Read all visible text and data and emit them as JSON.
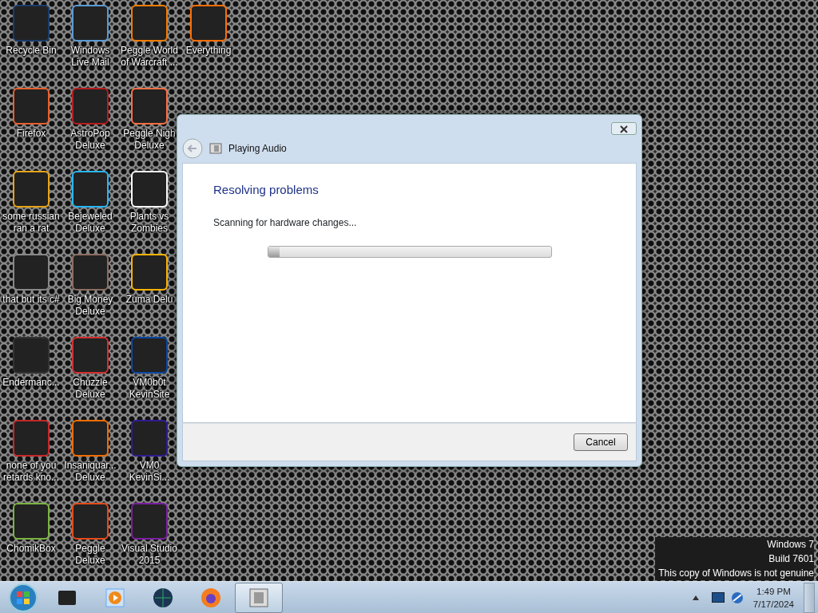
{
  "desktop_icons": [
    {
      "label": "Recycle Bin"
    },
    {
      "label": "Firefox"
    },
    {
      "label": "some russian ran a rat"
    },
    {
      "label": "that but its c#"
    },
    {
      "label": "Endermanc..."
    },
    {
      "label": "none of you retards kno..."
    },
    {
      "label": "ChomikBox"
    },
    {
      "label": "Windows Live Mail"
    },
    {
      "label": "AstroPop Deluxe"
    },
    {
      "label": "Bejeweled Deluxe"
    },
    {
      "label": "Big Money Deluxe"
    },
    {
      "label": "Chuzzle Deluxe"
    },
    {
      "label": "Insaniquar... Deluxe"
    },
    {
      "label": "Peggle Deluxe"
    },
    {
      "label": "Peggle World of Warcraft ..."
    },
    {
      "label": "Peggle Nigh Deluxe"
    },
    {
      "label": "Plants vs Zombies"
    },
    {
      "label": "Zuma Delu"
    },
    {
      "label": "VM0b0t KevinSite"
    },
    {
      "label": "VM0 KevinSi..."
    },
    {
      "label": "Visual Studio 2015"
    },
    {
      "label": "Everything"
    }
  ],
  "dialog": {
    "title": "Playing Audio",
    "heading": "Resolving problems",
    "status": "Scanning for hardware changes...",
    "progress": {
      "level": 0.04
    },
    "buttons": [
      "Cancel"
    ]
  },
  "system_notice": [
    "Windows 7",
    "Build 7601",
    "This copy of Windows is not genuine"
  ],
  "taskbar": {
    "items": [
      {
        "selected": false
      },
      {
        "selected": false
      },
      {
        "selected": false
      },
      {
        "selected": false
      },
      {
        "selected": true
      }
    ],
    "clock": {
      "time": "1:49 PM",
      "date": "7/17/2024"
    }
  }
}
